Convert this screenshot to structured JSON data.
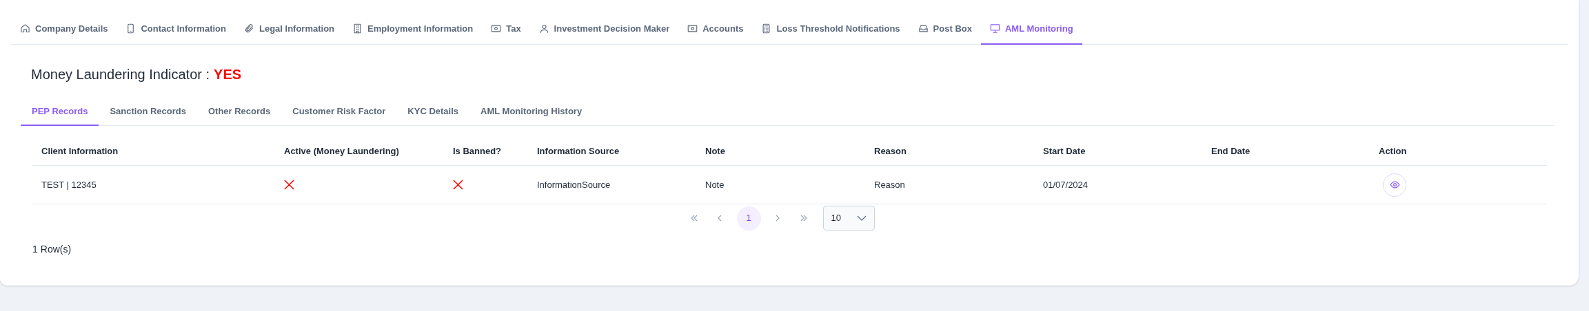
{
  "tabs": [
    {
      "label": "Company Details",
      "selected": false
    },
    {
      "label": "Contact Information",
      "selected": false
    },
    {
      "label": "Legal Information",
      "selected": false
    },
    {
      "label": "Employment Information",
      "selected": false
    },
    {
      "label": "Tax",
      "selected": false
    },
    {
      "label": "Investment Decision Maker",
      "selected": false
    },
    {
      "label": "Accounts",
      "selected": false
    },
    {
      "label": "Loss Threshold Notifications",
      "selected": false
    },
    {
      "label": "Post Box",
      "selected": false
    },
    {
      "label": "AML Monitoring",
      "selected": true
    }
  ],
  "indicator": {
    "label": "Money Laundering Indicator :",
    "value": "YES"
  },
  "sub_tabs": [
    {
      "label": "PEP Records",
      "selected": true
    },
    {
      "label": "Sanction Records",
      "selected": false
    },
    {
      "label": "Other Records",
      "selected": false
    },
    {
      "label": "Customer Risk Factor",
      "selected": false
    },
    {
      "label": "KYC Details",
      "selected": false
    },
    {
      "label": "AML Monitoring History",
      "selected": false
    }
  ],
  "table": {
    "columns": [
      "Client Information",
      "Active (Money Laundering)",
      "Is Banned?",
      "Information Source",
      "Note",
      "Reason",
      "Start Date",
      "End Date",
      "Action"
    ],
    "rows": [
      {
        "client_information": "TEST | 12345",
        "active": false,
        "banned": false,
        "information_source": "InformationSource",
        "note": "Note",
        "reason": "Reason",
        "start_date": "01/07/2024"
      }
    ]
  },
  "pagination": {
    "pages": [
      {
        "label": "1",
        "selected": true
      }
    ],
    "page_size": "10"
  },
  "row_count": {
    "count": "1",
    "label": "Row(s)"
  }
}
